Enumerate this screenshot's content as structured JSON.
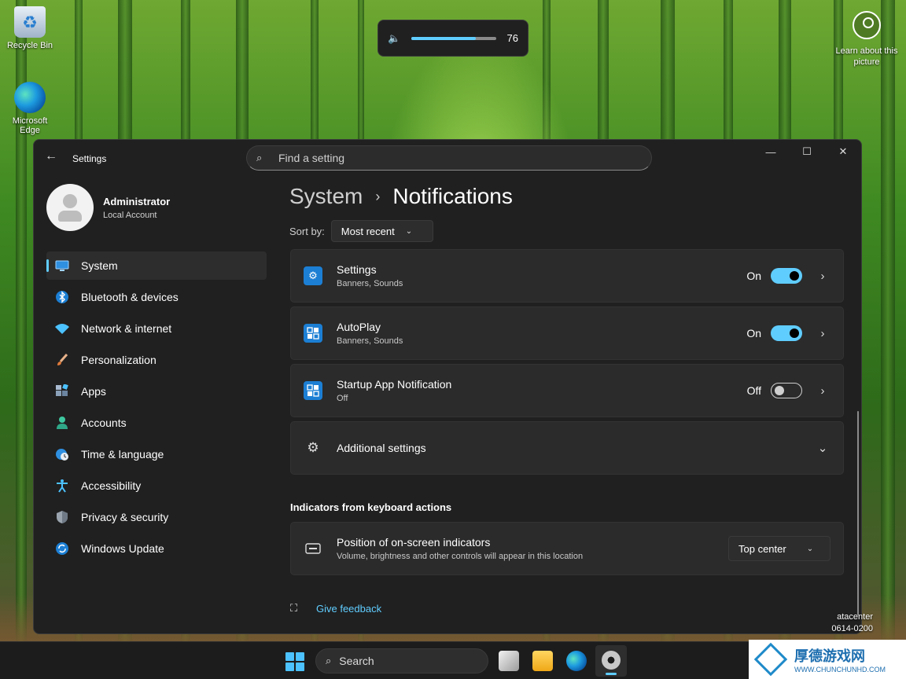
{
  "desktop": {
    "icons": [
      {
        "label": "Recycle Bin"
      },
      {
        "label": "Microsoft Edge"
      }
    ],
    "learn_picture": "Learn about this picture",
    "watermark": [
      "atacenter",
      "0614-0200"
    ]
  },
  "volume_flyout": {
    "value": "76",
    "level": 0.76,
    "icon": "speaker-icon"
  },
  "window": {
    "app_title": "Settings",
    "search_placeholder": "Find a setting",
    "user": {
      "name": "Administrator",
      "account_type": "Local Account"
    },
    "nav": [
      {
        "label": "System",
        "icon": "monitor-icon",
        "active": true
      },
      {
        "label": "Bluetooth & devices",
        "icon": "bluetooth-icon"
      },
      {
        "label": "Network & internet",
        "icon": "wifi-icon"
      },
      {
        "label": "Personalization",
        "icon": "brush-icon"
      },
      {
        "label": "Apps",
        "icon": "apps-icon"
      },
      {
        "label": "Accounts",
        "icon": "person-icon"
      },
      {
        "label": "Time & language",
        "icon": "globe-clock-icon"
      },
      {
        "label": "Accessibility",
        "icon": "accessibility-icon"
      },
      {
        "label": "Privacy & security",
        "icon": "shield-icon"
      },
      {
        "label": "Windows Update",
        "icon": "update-icon"
      }
    ],
    "breadcrumb": {
      "parent": "System",
      "separator": "›",
      "current": "Notifications"
    },
    "sort": {
      "label": "Sort by:",
      "value": "Most recent"
    },
    "apps": [
      {
        "name": "Settings",
        "detail": "Banners, Sounds",
        "state": "On",
        "enabled": true,
        "icon": "settings-gear-icon"
      },
      {
        "name": "AutoPlay",
        "detail": "Banners, Sounds",
        "state": "On",
        "enabled": true,
        "icon": "autoplay-icon"
      },
      {
        "name": "Startup App Notification",
        "detail": "Off",
        "state": "Off",
        "enabled": false,
        "icon": "startup-app-icon"
      }
    ],
    "additional_settings": "Additional settings",
    "indicators_section": "Indicators from keyboard actions",
    "position": {
      "title": "Position of on-screen indicators",
      "description": "Volume, brightness and other controls will appear in this location",
      "value": "Top center"
    },
    "feedback": "Give feedback"
  },
  "taskbar": {
    "search_label": "Search"
  },
  "badge": {
    "title": "厚德游戏网",
    "url": "WWW.CHUNCHUNHD.COM"
  },
  "colors": {
    "accent": "#60cdff",
    "window_bg": "#202020",
    "card_bg": "#2b2b2b"
  }
}
